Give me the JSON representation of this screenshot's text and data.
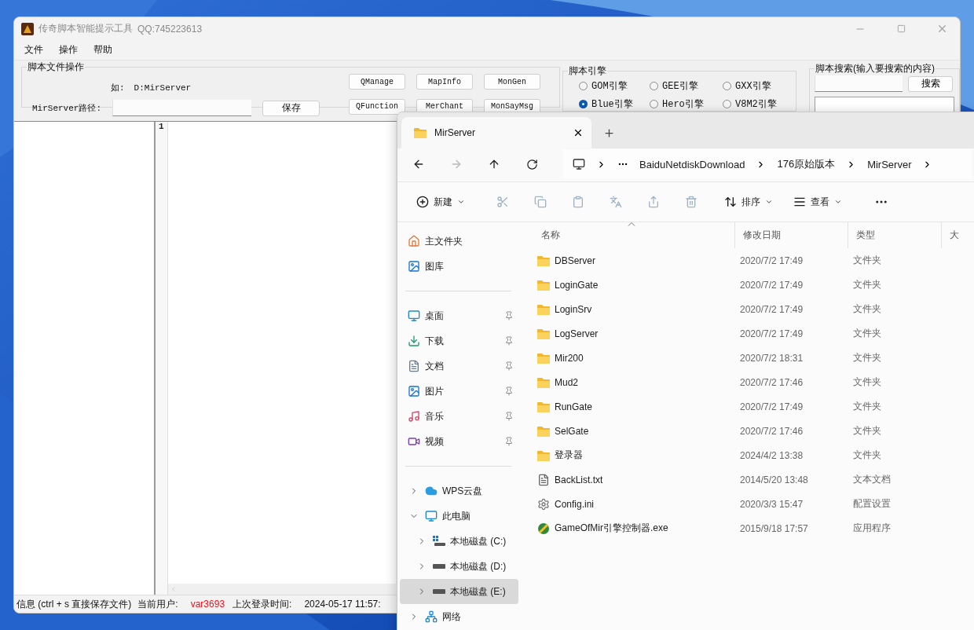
{
  "tool_window": {
    "title": "传奇脚本智能提示工具",
    "qq": "QQ:745223613",
    "menu": [
      "文件",
      "操作",
      "帮助"
    ],
    "file_ops": {
      "title": "脚本文件操作",
      "example_label": "如:",
      "example_value": "D:MirServer",
      "path_label": "MirServer路径:",
      "save_button": "保存",
      "buttons": [
        "QManage",
        "MapInfo",
        "MonGen",
        "QFunction",
        "MerChant",
        "MonSayMsg"
      ]
    },
    "engine": {
      "title": "脚本引擎",
      "options": [
        {
          "label": "GOM引擎",
          "selected": false
        },
        {
          "label": "GEE引擎",
          "selected": false
        },
        {
          "label": "GXX引擎",
          "selected": false
        },
        {
          "label": "Blue引擎",
          "selected": true
        },
        {
          "label": "Hero引擎",
          "selected": false
        },
        {
          "label": "V8M2引擎",
          "selected": false
        }
      ]
    },
    "search": {
      "title": "脚本搜索(输入要搜索的内容)",
      "button": "搜索"
    },
    "editor": {
      "line_numbers": [
        "1"
      ]
    },
    "status_bar": {
      "info": "信息 (ctrl + s 直接保存文件)",
      "user_label": "当前用户:",
      "user": "var3693",
      "login_label": "上次登录时间:",
      "login_time": "2024-05-17 11:57:"
    }
  },
  "explorer": {
    "tab": {
      "title": "MirServer"
    },
    "breadcrumb": [
      "BaiduNetdiskDownload",
      "176原始版本",
      "MirServer"
    ],
    "toolbar": {
      "new": "新建",
      "sort": "排序",
      "view": "查看"
    },
    "columns": [
      "名称",
      "修改日期",
      "类型",
      "大"
    ],
    "sidebar": [
      [
        {
          "label": "主文件夹",
          "kind": "home",
          "selected": false
        },
        {
          "label": "图库",
          "kind": "gallery",
          "selected": false
        }
      ],
      [
        {
          "label": "桌面",
          "kind": "desktop",
          "selected": false,
          "pinned": true
        },
        {
          "label": "下载",
          "kind": "download",
          "selected": false,
          "pinned": true
        },
        {
          "label": "文档",
          "kind": "document",
          "selected": false,
          "pinned": true
        },
        {
          "label": "图片",
          "kind": "pictures",
          "selected": false,
          "pinned": true
        },
        {
          "label": "音乐",
          "kind": "music",
          "selected": false,
          "pinned": true
        },
        {
          "label": "视频",
          "kind": "video",
          "selected": false,
          "pinned": true
        }
      ],
      [
        {
          "label": "WPS云盘",
          "kind": "cloud",
          "selected": false,
          "expanded": false
        },
        {
          "label": "此电脑",
          "kind": "pc",
          "selected": false,
          "expanded": true,
          "children": [
            {
              "label": "本地磁盘 (C:)",
              "kind": "system-drive",
              "selected": false,
              "expanded": false
            },
            {
              "label": "本地磁盘 (D:)",
              "kind": "drive",
              "selected": false,
              "expanded": false
            },
            {
              "label": "本地磁盘 (E:)",
              "kind": "drive",
              "selected": true,
              "expanded": false
            }
          ]
        },
        {
          "label": "网络",
          "kind": "network",
          "selected": false,
          "expanded": false
        }
      ]
    ],
    "files": [
      {
        "name": "DBServer",
        "modified": "2020/7/2 17:49",
        "type": "文件夹",
        "kind": "folder"
      },
      {
        "name": "LoginGate",
        "modified": "2020/7/2 17:49",
        "type": "文件夹",
        "kind": "folder"
      },
      {
        "name": "LoginSrv",
        "modified": "2020/7/2 17:49",
        "type": "文件夹",
        "kind": "folder"
      },
      {
        "name": "LogServer",
        "modified": "2020/7/2 17:49",
        "type": "文件夹",
        "kind": "folder"
      },
      {
        "name": "Mir200",
        "modified": "2020/7/2 18:31",
        "type": "文件夹",
        "kind": "folder"
      },
      {
        "name": "Mud2",
        "modified": "2020/7/2 17:46",
        "type": "文件夹",
        "kind": "folder"
      },
      {
        "name": "RunGate",
        "modified": "2020/7/2 17:49",
        "type": "文件夹",
        "kind": "folder"
      },
      {
        "name": "SelGate",
        "modified": "2020/7/2 17:46",
        "type": "文件夹",
        "kind": "folder"
      },
      {
        "name": "登录器",
        "modified": "2024/4/2 13:38",
        "type": "文件夹",
        "kind": "folder"
      },
      {
        "name": "BackList.txt",
        "modified": "2014/5/20 13:48",
        "type": "文本文档",
        "kind": "text"
      },
      {
        "name": "Config.ini",
        "modified": "2020/3/3 15:47",
        "type": "配置设置",
        "kind": "config"
      },
      {
        "name": "GameOfMir引擎控制器.exe",
        "modified": "2015/9/18 17:57",
        "type": "应用程序",
        "kind": "exe"
      }
    ]
  }
}
